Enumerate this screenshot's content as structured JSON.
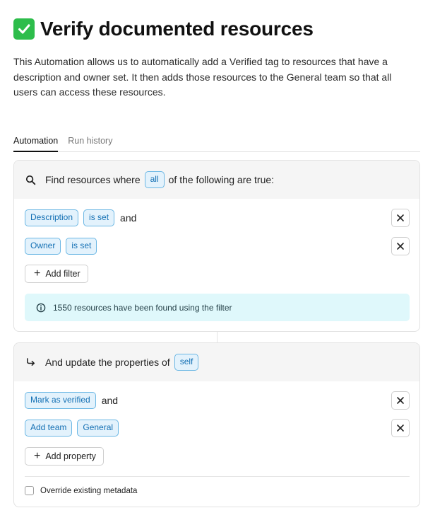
{
  "title": "Verify documented resources",
  "description": "This Automation allows us to automatically add a Verified tag to resources that have a description and owner set. It then adds those resources to the General team so that all users can access these resources.",
  "tabs": [
    {
      "label": "Automation",
      "active": true
    },
    {
      "label": "Run history",
      "active": false
    }
  ],
  "filter_card": {
    "prefix": "Find resources where",
    "quantifier": "all",
    "suffix": "of the following are true:",
    "conditions": [
      {
        "field": "Description",
        "operator": "is set",
        "conjunction": "and"
      },
      {
        "field": "Owner",
        "operator": "is set",
        "conjunction": ""
      }
    ],
    "add_label": "Add filter",
    "info_text": "1550 resources have been found using the filter"
  },
  "update_card": {
    "prefix": "And update the properties of",
    "target": "self",
    "actions": [
      {
        "action": "Mark as verified",
        "value": "",
        "conjunction": "and"
      },
      {
        "action": "Add team",
        "value": "General",
        "conjunction": ""
      }
    ],
    "add_label": "Add property",
    "override_label": "Override existing metadata",
    "override_checked": false
  },
  "colors": {
    "chip_bg": "#e3f2fc",
    "chip_border": "#6bb7e4",
    "chip_text": "#1470b4",
    "info_bg": "#dff8fb",
    "check_green": "#2dbd4b"
  }
}
